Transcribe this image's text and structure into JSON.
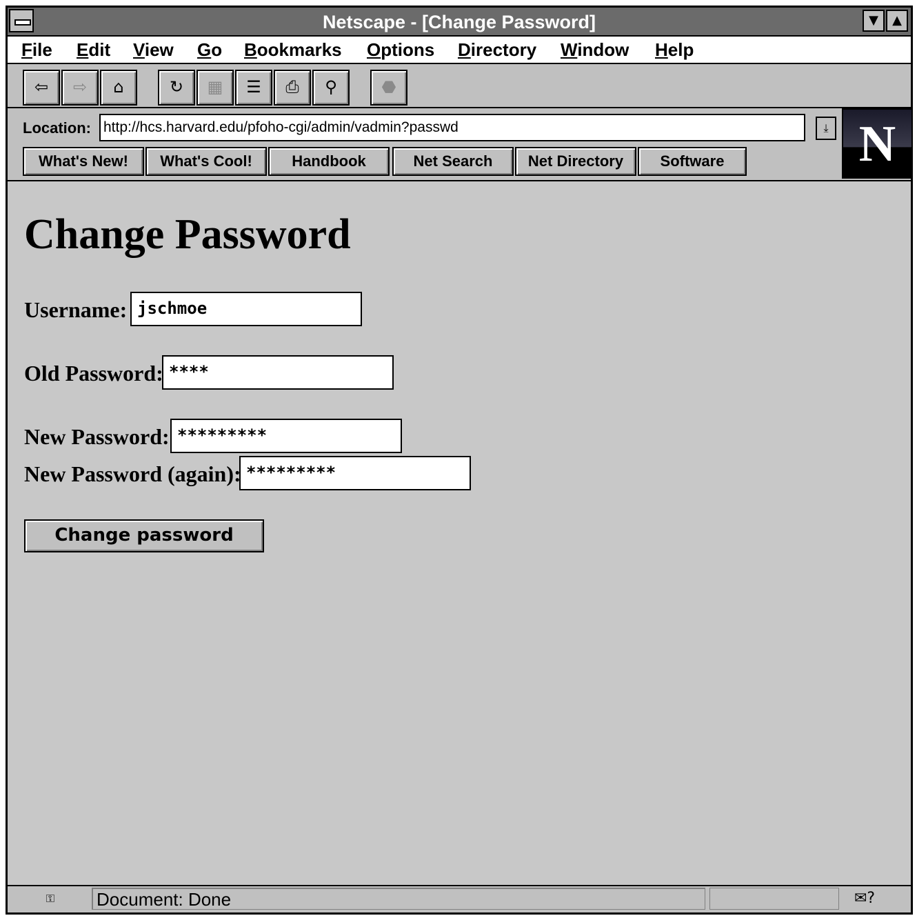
{
  "window": {
    "title": "Netscape - [Change Password]"
  },
  "menu": [
    {
      "label": "File",
      "u": "F",
      "rest": "ile"
    },
    {
      "label": "Edit",
      "u": "E",
      "rest": "dit"
    },
    {
      "label": "View",
      "u": "V",
      "rest": "iew"
    },
    {
      "label": "Go",
      "u": "G",
      "rest": "o"
    },
    {
      "label": "Bookmarks",
      "u": "B",
      "rest": "ookmarks"
    },
    {
      "label": "Options",
      "u": "O",
      "rest": "ptions"
    },
    {
      "label": "Directory",
      "u": "D",
      "rest": "irectory"
    },
    {
      "label": "Window",
      "u": "W",
      "rest": "indow"
    },
    {
      "label": "Help",
      "u": "H",
      "rest": "elp"
    }
  ],
  "toolbar": {
    "icons": [
      "back-icon",
      "forward-icon",
      "home-icon",
      "reload-icon",
      "images-icon",
      "open-icon",
      "print-icon",
      "find-icon",
      "stop-icon"
    ]
  },
  "location": {
    "label": "Location:",
    "url": "http://hcs.harvard.edu/pfoho-cgi/admin/vadmin?passwd"
  },
  "directory_buttons": [
    "What's New!",
    "What's Cool!",
    "Handbook",
    "Net Search",
    "Net Directory",
    "Software"
  ],
  "logo": {
    "letter": "N"
  },
  "page": {
    "title": "Change Password",
    "username_label": "Username:",
    "username_value": "jschmoe",
    "old_password_label": "Old Password:",
    "old_password_value": "****",
    "new_password_label": "New Password:",
    "new_password_value": "*********",
    "new_password_again_label": "New Password (again):",
    "new_password_again_value": "*********",
    "submit_label": "Change password"
  },
  "status": {
    "text": "Document: Done"
  }
}
